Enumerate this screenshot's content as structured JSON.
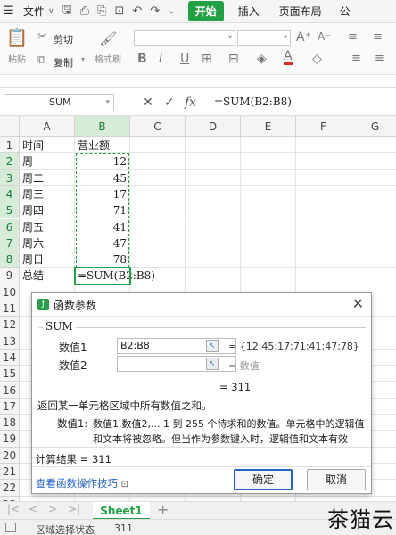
{
  "menubar": {
    "file_label": "文件",
    "tabs": [
      "开始",
      "插入",
      "页面布局",
      "公"
    ]
  },
  "ribbon": {
    "paste_label": "粘贴",
    "cut_label": "剪切",
    "copy_label": "复制",
    "format_painter_label": "格式刷",
    "bold": "B",
    "italic": "I",
    "underline": "U",
    "font_color": "A",
    "grow_font": "A⁺",
    "shrink_font": "A⁻"
  },
  "formula_bar": {
    "name_box": "SUM",
    "cancel": "✕",
    "confirm": "✓",
    "fx": "fx",
    "formula": "=SUM(B2:B8)"
  },
  "grid": {
    "columns": [
      "A",
      "B",
      "C",
      "D",
      "E",
      "F",
      "G"
    ],
    "rows": [
      "1",
      "2",
      "3",
      "4",
      "5",
      "6",
      "7",
      "8",
      "9",
      "10",
      "11",
      "12",
      "13",
      "14",
      "15",
      "16",
      "17",
      "18",
      "19",
      "20",
      "21",
      "22",
      "23"
    ],
    "cells": {
      "A1": "时间",
      "B1": "营业额",
      "A2": "周一",
      "B2": "12",
      "A3": "周二",
      "B3": "45",
      "A4": "周三",
      "B4": "17",
      "A5": "周四",
      "B5": "71",
      "A6": "周五",
      "B6": "41",
      "A7": "周六",
      "B7": "47",
      "A8": "周日",
      "B8": "78",
      "A9": "总结",
      "B9": "=SUM(B2:B8)"
    }
  },
  "dialog": {
    "title": "函数参数",
    "function_name": "SUM",
    "arg1_label": "数值1",
    "arg1_value": "B2:B8",
    "arg1_result": "= {12;45;17;71;41;47;78}",
    "arg2_label": "数值2",
    "arg2_result": "= 数值",
    "total": "= 311",
    "description": "返回某一单元格区域中所有数值之和。",
    "param_label": "数值1:",
    "param_desc_1": "数值1,数值2,... 1 到 255 个待求和的数值。单元格中的逻辑值",
    "param_desc_2": "和文本将被忽略。但当作为参数键入时，逻辑值和文本有效",
    "calc_result": "计算结果 = 311",
    "help_link": "查看函数操作技巧",
    "ok": "确定",
    "cancel": "取消"
  },
  "sheets": {
    "active": "Sheet1",
    "add": "+"
  },
  "status": {
    "mode": "区域选择状态",
    "value": "311"
  },
  "watermark": "茶猫云"
}
